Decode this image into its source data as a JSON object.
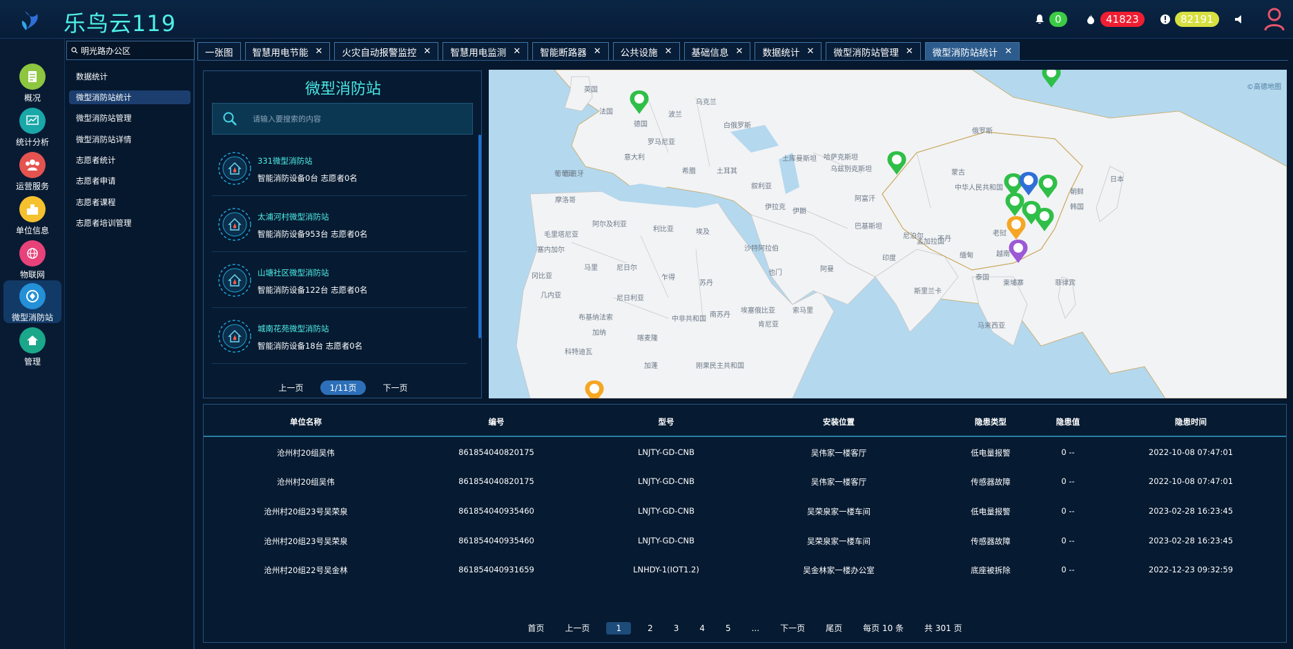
{
  "header": {
    "title": "乐鸟云119",
    "stats": [
      {
        "icon": "bell-icon",
        "count": "0",
        "color": "#3ccb45"
      },
      {
        "icon": "fire-icon",
        "count": "41823",
        "color": "#f01e32"
      },
      {
        "icon": "alert-icon",
        "count": "82191",
        "color": "#d7e040"
      }
    ]
  },
  "rail": [
    {
      "label": "概况",
      "icon": "overview-icon",
      "color": "#8dc63f"
    },
    {
      "label": "统计分析",
      "icon": "chart-icon",
      "color": "#1aa7a8"
    },
    {
      "label": "运营服务",
      "icon": "users-icon",
      "color": "#e4534f"
    },
    {
      "label": "单位信息",
      "icon": "building-icon",
      "color": "#f5c12e"
    },
    {
      "label": "物联网",
      "icon": "globe-icon",
      "color": "#e8427a"
    },
    {
      "label": "微型消防站",
      "icon": "station-icon",
      "color": "#2390d8"
    },
    {
      "label": "管理",
      "icon": "home-icon",
      "color": "#1aa78a"
    }
  ],
  "submenu": {
    "org": "明光路办公区",
    "items": [
      "数据统计",
      "微型消防站统计",
      "微型消防站管理",
      "微型消防站详情",
      "志愿者统计",
      "志愿者申请",
      "志愿者课程",
      "志愿者培训管理"
    ]
  },
  "tabs": [
    "一张图",
    "智慧用电节能",
    "火灾自动报警监控",
    "智慧用电监测",
    "智能断路器",
    "公共设施",
    "基础信息",
    "数据统计",
    "微型消防站管理",
    "微型消防站统计"
  ],
  "panel": {
    "title": "微型消防站",
    "search_placeholder": "请输入要搜索的内容",
    "stations": [
      {
        "name": "331微型消防站",
        "info": "智能消防设备0台  志愿者0名"
      },
      {
        "name": "太浦河村微型消防站",
        "info": "智能消防设备953台  志愿者0名"
      },
      {
        "name": "山塘社区微型消防站",
        "info": "智能消防设备122台  志愿者0名"
      },
      {
        "name": "城南花苑微型消防站",
        "info": "智能消防设备18台  志愿者0名"
      }
    ],
    "prev": "上一页",
    "page": "1/11页",
    "next": "下一页"
  },
  "map": {
    "credit": "©高德地图",
    "labels": [
      "英国",
      "波兰",
      "乌克兰",
      "法国",
      "西班牙",
      "葡萄牙",
      "意大利",
      "希腊",
      "土耳其",
      "叙利亚",
      "伊拉克",
      "伊朗",
      "沙特阿拉伯",
      "埃及",
      "利比亚",
      "阿尔及利亚",
      "摩洛哥",
      "马里",
      "尼日尔",
      "乍得",
      "苏丹",
      "尼日利亚",
      "埃塞俄比亚",
      "肯尼亚",
      "哈萨克斯坦",
      "蒙古",
      "中华人民共和国",
      "印度",
      "巴基斯坦",
      "阿富汗",
      "俄罗斯",
      "日本",
      "缅甸",
      "泰国",
      "越南",
      "菲律宾",
      "马来西亚",
      "也门",
      "阿曼",
      "土库曼斯坦",
      "乌兹别克斯坦",
      "白俄罗斯",
      "德国",
      "罗马尼亚",
      "塞内加尔",
      "毛里塔尼亚",
      "孟加拉国",
      "斯里兰卡",
      "老挝",
      "柬埔寨",
      "索马里",
      "南苏丹",
      "中非共和国",
      "刚果民主共和国",
      "喀麦隆",
      "加蓬",
      "科特迪瓦",
      "几内亚",
      "加纳",
      "布基纳法索",
      "冈比亚",
      "韩国",
      "朝鲜",
      "尼泊尔",
      "不丹"
    ]
  },
  "table": {
    "headers": [
      "单位名称",
      "编号",
      "型号",
      "安装位置",
      "隐患类型",
      "隐患值",
      "隐患时间"
    ],
    "rows": [
      [
        "沧州村20组吴伟",
        "861854040820175",
        "LNJTY-GD-CNB",
        "吴伟家一楼客厅",
        "低电量报警",
        "0 --",
        "2022-10-08 07:47:01"
      ],
      [
        "沧州村20组吴伟",
        "861854040820175",
        "LNJTY-GD-CNB",
        "吴伟家一楼客厅",
        "传感器故障",
        "0 --",
        "2022-10-08 07:47:01"
      ],
      [
        "沧州村20组23号吴荣泉",
        "861854040935460",
        "LNJTY-GD-CNB",
        "吴荣泉家一楼车间",
        "低电量报警",
        "0 --",
        "2023-02-28 16:23:45"
      ],
      [
        "沧州村20组23号吴荣泉",
        "861854040935460",
        "LNJTY-GD-CNB",
        "吴荣泉家一楼车间",
        "传感器故障",
        "0 --",
        "2023-02-28 16:23:45"
      ],
      [
        "沧州村20组22号吴金林",
        "861854040931659",
        "LNHDY-1(IOT1.2)",
        "吴金林家一楼办公室",
        "底座被拆除",
        "0 --",
        "2022-12-23 09:32:59"
      ]
    ],
    "pagination": {
      "first": "首页",
      "prev": "上一页",
      "pages": [
        "1",
        "2",
        "3",
        "4",
        "5",
        "..."
      ],
      "next": "下一页",
      "last": "尾页",
      "per_page": "每页 10 条",
      "total": "共 301 页"
    }
  }
}
